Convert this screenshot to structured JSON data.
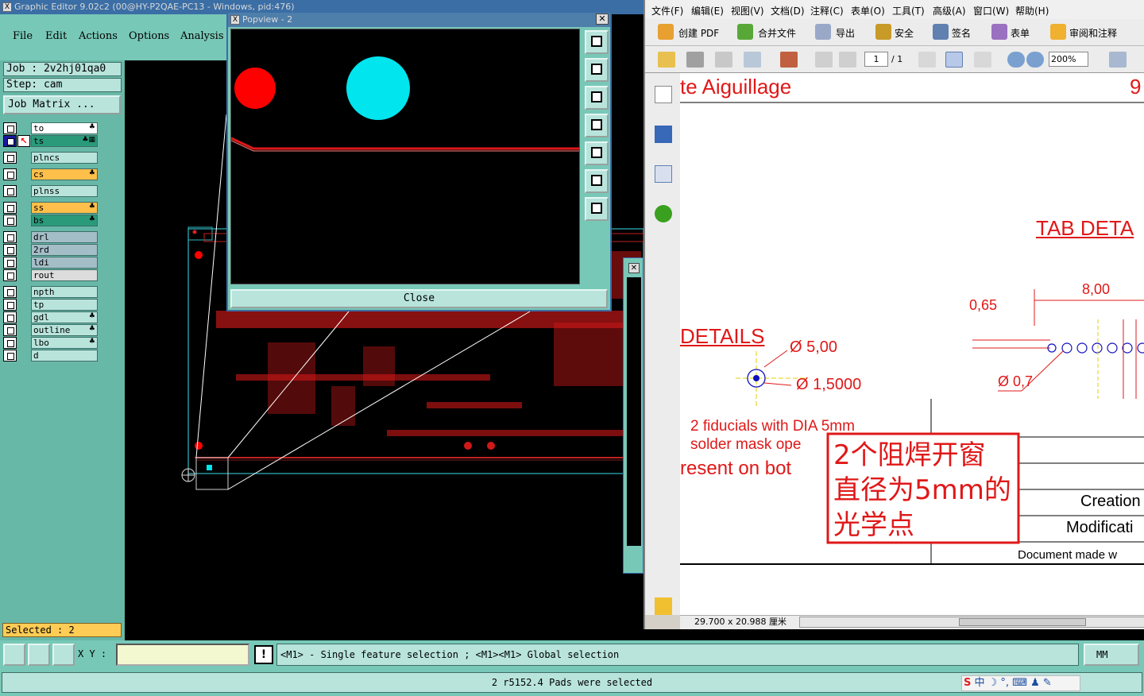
{
  "ge": {
    "title": "Graphic Editor 9.02c2 (00@HY-P2QAE-PC13 - Windows, pid:476)",
    "menus": [
      "File",
      "Edit",
      "Actions",
      "Options",
      "Analysis"
    ],
    "job": "Job : 2v2hj01qa0",
    "step": "Step: cam",
    "matrix_button": "Job Matrix ...",
    "layers": [
      {
        "name": "to",
        "color": "#ffffff",
        "mark": "♣"
      },
      {
        "name": "ts",
        "color": "#2a9a7a",
        "mark": "♣▦"
      },
      {
        "name": "plncs",
        "color": "#b8e4dc",
        "mark": ""
      },
      {
        "name": "cs",
        "color": "#ffbf4a",
        "mark": "♣"
      },
      {
        "name": "plnss",
        "color": "#b8e4dc",
        "mark": ""
      },
      {
        "name": "ss",
        "color": "#ffbf4a",
        "mark": "♣"
      },
      {
        "name": "bs",
        "color": "#2a9a7a",
        "mark": "♣"
      },
      {
        "name": "drl",
        "color": "#a4bec8",
        "mark": ""
      },
      {
        "name": "2rd",
        "color": "#a4bec8",
        "mark": ""
      },
      {
        "name": "ldi",
        "color": "#a4bec8",
        "mark": ""
      },
      {
        "name": "rout",
        "color": "#dcdcdc",
        "mark": ""
      },
      {
        "name": "npth",
        "color": "#b8e4dc",
        "mark": ""
      },
      {
        "name": "tp",
        "color": "#b8e4dc",
        "mark": ""
      },
      {
        "name": "gdl",
        "color": "#b8e4dc",
        "mark": "♣"
      },
      {
        "name": "outline",
        "color": "#b8e4dc",
        "mark": "♣"
      },
      {
        "name": "lbo",
        "color": "#b8e4dc",
        "mark": "♣"
      },
      {
        "name": "d",
        "color": "#b8e4dc",
        "mark": ""
      }
    ],
    "selected": "Selected : 2",
    "xy_label": "X Y :",
    "xy_value": "",
    "hint": "<M1> - Single feature selection ; <M1><M1> Global selection",
    "unit": "MM",
    "status": "2 r5152.4 Pads were selected"
  },
  "popview": {
    "title": "Popview - 2",
    "close_label": "Close",
    "colors": {
      "pad_red": "#ff0000",
      "pad_cyan": "#00e5ee"
    }
  },
  "pdf": {
    "menus": [
      "文件(F)",
      "编辑(E)",
      "视图(V)",
      "文档(D)",
      "注释(C)",
      "表单(O)",
      "工具(T)",
      "高级(A)",
      "窗口(W)",
      "帮助(H)"
    ],
    "toolbar1": [
      "创建 PDF",
      "合并文件",
      "导出",
      "安全",
      "签名",
      "表单",
      "审阅和注释"
    ],
    "page_current": "1",
    "page_total": "/ 1",
    "zoom": "200%",
    "page_size": "29.700 x 20.988 厘米",
    "content": {
      "heading": "te Aiguillage",
      "heading_num": "9",
      "tab_detail": "TAB DETA",
      "details": "DETAILS",
      "dia1": "Ø 5,00",
      "dia2": "Ø 1,5000",
      "dim_065": "0,65",
      "dim_800": "8,00",
      "dim_07": "Ø 0,7",
      "note1": "2 fiducials with DIA 5mm",
      "note2": "solder mask ope",
      "note3": "resent on bot",
      "annotation": [
        "2个阻焊开窗",
        "直径为5mm的",
        "光学点"
      ],
      "creation": "Creation",
      "modification": "Modificati",
      "doc_made": "Document made w"
    }
  }
}
